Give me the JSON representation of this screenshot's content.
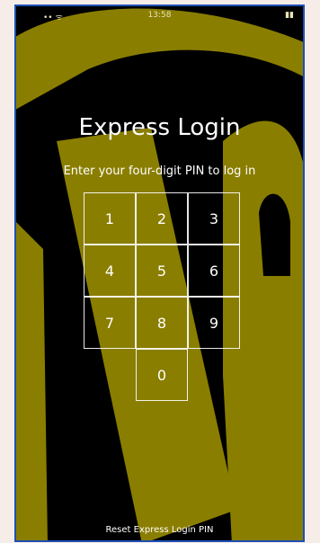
{
  "status_bar": {
    "time": "13:58",
    "left_icons": "••  ᯤ",
    "right_icons": "▮▮"
  },
  "login": {
    "title": "Express Login",
    "subtitle": "Enter your four-digit PIN to log in",
    "reset_link": "Reset Express Login PIN"
  },
  "keypad": {
    "keys": [
      "1",
      "2",
      "3",
      "4",
      "5",
      "6",
      "7",
      "8",
      "9",
      "0"
    ]
  },
  "colors": {
    "background": "#000000",
    "logo_fill": "#8a7e00",
    "frame_border": "#1e4fb4",
    "text": "#ffffff"
  }
}
